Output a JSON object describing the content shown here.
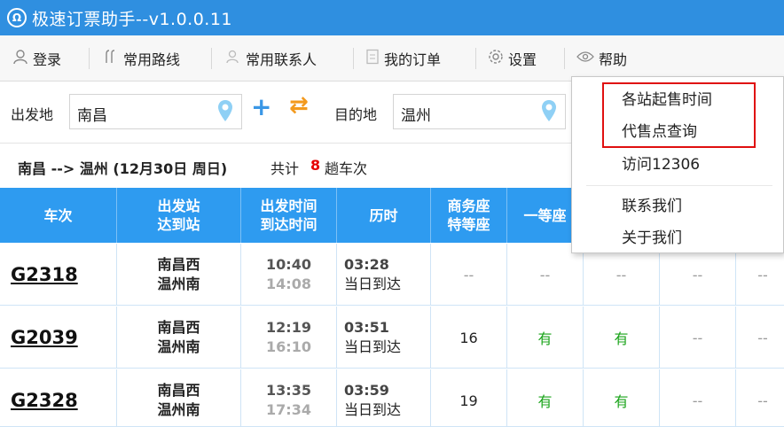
{
  "app": {
    "title": "极速订票助手--v1.0.0.11",
    "logo_icon": "train-logo-icon",
    "colors": {
      "titlebar": "#2f8fe0",
      "header": "#2e9bf0",
      "available": "#19a319",
      "count": "#e60000",
      "highlight": "#e01010"
    }
  },
  "toolbar": {
    "login": "登录",
    "routes": "常用路线",
    "contacts": "常用联系人",
    "orders": "我的订单",
    "settings": "设置",
    "help": "帮助"
  },
  "search": {
    "from_label": "出发地",
    "from_value": "南昌",
    "to_label": "目的地",
    "to_value": "温州"
  },
  "summary": {
    "route": "南昌 --> 温州 (12月30日 周日)",
    "total_label": "共计",
    "count": "8",
    "unit": "趟车次"
  },
  "table": {
    "headers": {
      "train": "车次",
      "stations_1": "出发站",
      "stations_2": "达到站",
      "time_1": "出发时间",
      "time_2": "到达时间",
      "duration": "历时",
      "business_1": "商务座",
      "business_2": "特等座",
      "first": "一等座"
    },
    "rows": [
      {
        "code": "G2318",
        "from": "南昌西",
        "to": "温州南",
        "dep": "10:40",
        "arr": "14:08",
        "dur": "03:28",
        "note": "当日到达",
        "business": "--",
        "first": "--",
        "second": "--",
        "c4": "--",
        "c5": "--"
      },
      {
        "code": "G2039",
        "from": "南昌西",
        "to": "温州南",
        "dep": "12:19",
        "arr": "16:10",
        "dur": "03:51",
        "note": "当日到达",
        "business": "16",
        "first": "有",
        "second": "有",
        "c4": "--",
        "c5": "--"
      },
      {
        "code": "G2328",
        "from": "南昌西",
        "to": "温州南",
        "dep": "13:35",
        "arr": "17:34",
        "dur": "03:59",
        "note": "当日到达",
        "business": "19",
        "first": "有",
        "second": "有",
        "c4": "--",
        "c5": "--"
      }
    ]
  },
  "help_menu": {
    "items": [
      "各站起售时间",
      "代售点查询",
      "访问12306",
      "联系我们",
      "关于我们"
    ]
  }
}
